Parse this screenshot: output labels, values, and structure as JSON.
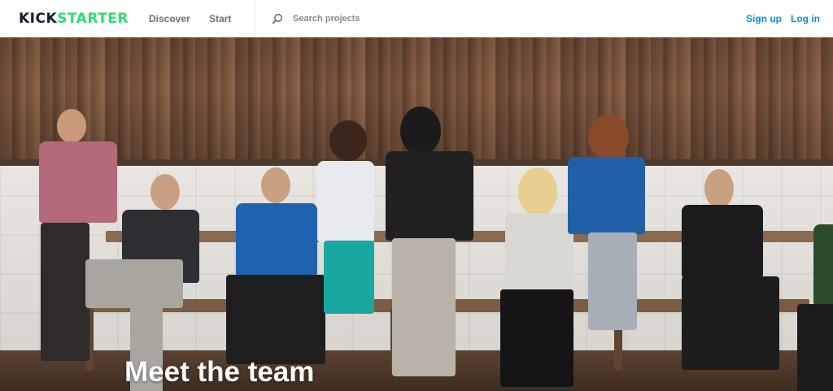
{
  "header": {
    "logo": {
      "part1": "KICK",
      "part2": "STARTER"
    },
    "nav": [
      {
        "label": "Discover"
      },
      {
        "label": "Start"
      }
    ],
    "search": {
      "placeholder": "Search projects",
      "icon": "search-icon"
    },
    "auth": {
      "signup": "Sign up",
      "login": "Log in"
    }
  },
  "hero": {
    "title": "Meet the team"
  },
  "colors": {
    "brand_dark": "#0f1e2b",
    "brand_green": "#2bde73",
    "link_blue": "#0a8fd6",
    "nav_gray": "#6e6e6e"
  }
}
